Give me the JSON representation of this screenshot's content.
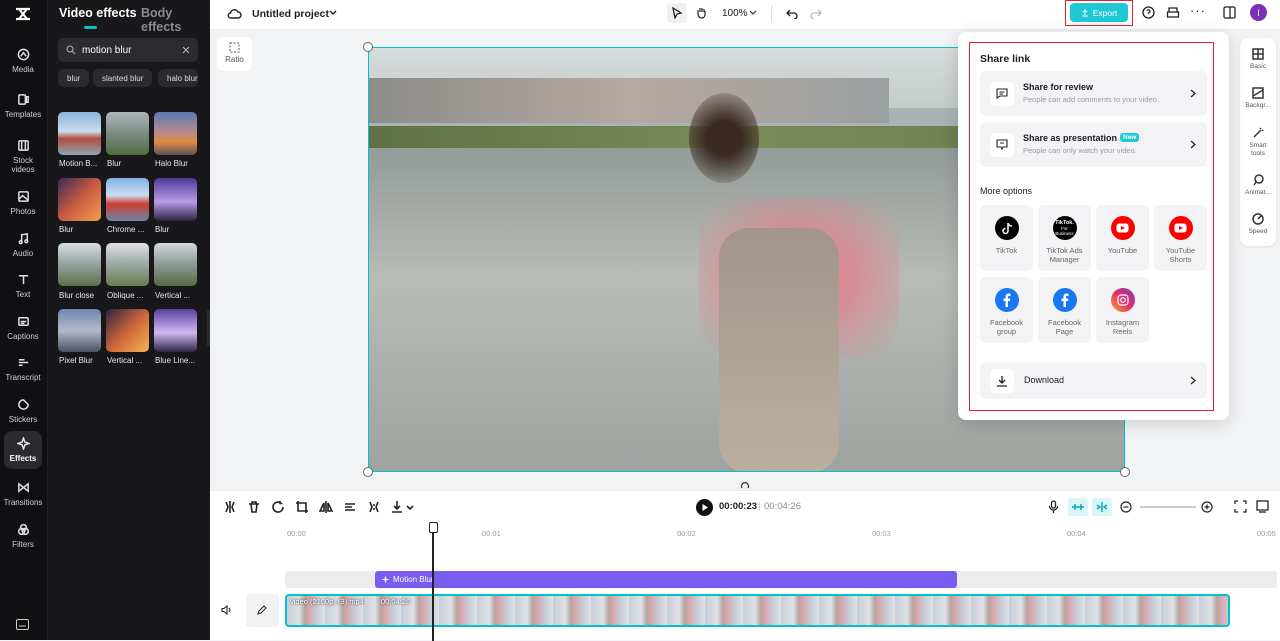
{
  "rail": {
    "items": [
      {
        "label": "Media",
        "icon": "media-icon"
      },
      {
        "label": "Templates",
        "icon": "templates-icon"
      },
      {
        "label": "Stock videos",
        "icon": "stock-videos-icon"
      },
      {
        "label": "Photos",
        "icon": "photos-icon"
      },
      {
        "label": "Audio",
        "icon": "audio-icon"
      },
      {
        "label": "Text",
        "icon": "text-icon"
      },
      {
        "label": "Captions",
        "icon": "captions-icon"
      },
      {
        "label": "Transcript",
        "icon": "transcript-icon"
      },
      {
        "label": "Stickers",
        "icon": "stickers-icon"
      },
      {
        "label": "Effects",
        "icon": "effects-icon"
      },
      {
        "label": "Transitions",
        "icon": "transitions-icon"
      },
      {
        "label": "Filters",
        "icon": "filters-icon"
      }
    ]
  },
  "panel": {
    "tab_video": "Video effects",
    "tab_body": "Body effects",
    "search_value": "motion blur",
    "chips": [
      "blur",
      "slanted blur",
      "halo blur"
    ],
    "effects": [
      {
        "label": "Motion B..."
      },
      {
        "label": "Blur"
      },
      {
        "label": "Halo Blur"
      },
      {
        "label": "Blur"
      },
      {
        "label": "Chrome ..."
      },
      {
        "label": "Blur"
      },
      {
        "label": "Blur close"
      },
      {
        "label": "Oblique ..."
      },
      {
        "label": "Vertical ..."
      },
      {
        "label": "Pixel Blur"
      },
      {
        "label": "Vertical ..."
      },
      {
        "label": "Blue Line..."
      }
    ]
  },
  "topbar": {
    "project_title": "Untitled project",
    "zoom": "100%",
    "export_label": "Export",
    "avatar_letter": "I"
  },
  "stage": {
    "ratio_label": "Ratio"
  },
  "props": {
    "items": [
      "Basic",
      "Backgr...",
      "Smart tools",
      "Animat...",
      "Speed"
    ]
  },
  "share": {
    "title": "Share link",
    "review_title": "Share for review",
    "review_sub": "People can add comments to your video.",
    "presentation_title": "Share as presentation",
    "presentation_badge": "New",
    "presentation_sub": "People can only watch your video.",
    "more_options": "More options",
    "platforms": [
      {
        "label": "TikTok"
      },
      {
        "label": "TikTok Ads Manager"
      },
      {
        "label": "YouTube"
      },
      {
        "label": "YouTube Shorts"
      },
      {
        "label": "Facebook group"
      },
      {
        "label": "Facebook Page"
      },
      {
        "label": "Instagram Reels"
      }
    ],
    "tiktok_business_text": "TikTok. For Business",
    "download_label": "Download"
  },
  "timeline": {
    "current_time": "00:00:23",
    "separator": "|",
    "total_time": "00:04:26",
    "ticks": [
      "00:00",
      "00:01",
      "00:02",
      "00:03",
      "00:04",
      "00:05"
    ],
    "effect_track_label": "Motion Blur",
    "clip_name": "video (2160p) (3).mp4",
    "clip_duration": "00:04:26"
  },
  "colors": {
    "accent": "#00c1cd",
    "effect_bar": "#7b5cf0",
    "highlight": "#e5202e",
    "export_bg": "#1fc8d4"
  }
}
